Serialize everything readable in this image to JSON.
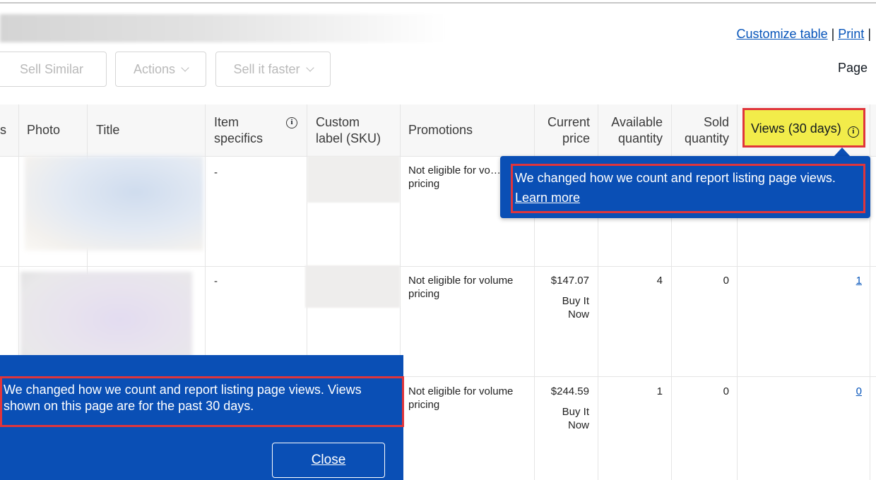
{
  "toolbar": {
    "customize_table": "Customize table",
    "separator": "|",
    "print": "Print",
    "sell_similar": "Sell Similar",
    "actions": "Actions",
    "sell_it_faster": "Sell it faster",
    "page_label": "Page"
  },
  "table": {
    "headers": {
      "partial_first": "s",
      "photo": "Photo",
      "title": "Title",
      "item_specifics_line1": "Item",
      "item_specifics_line2": "specifics",
      "custom_label_line1": "Custom",
      "custom_label_line2": "label (SKU)",
      "promotions": "Promotions",
      "current_price_line1": "Current",
      "current_price_line2": "price",
      "available_qty_line1": "Available",
      "available_qty_line2": "quantity",
      "sold_qty_line1": "Sold",
      "sold_qty_line2": "quantity",
      "views": "Views (30 days)"
    },
    "rows": [
      {
        "item_specifics": "-",
        "promotions": "Not eligible for vo…",
        "promotions_line2": "pricing"
      },
      {
        "item_specifics": "-",
        "promotions": "Not eligible for volume",
        "promotions_line2": "pricing",
        "price": "$147.07",
        "format_line1": "Buy It",
        "format_line2": "Now",
        "available": "4",
        "sold": "0",
        "views": "1"
      },
      {
        "promotions": "Not eligible for volume",
        "promotions_line2": "pricing",
        "price": "$244.59",
        "format_line1": "Buy It",
        "format_line2": "Now",
        "available": "1",
        "sold": "0",
        "views": "0"
      }
    ]
  },
  "tooltip": {
    "text": "We changed how we count and report listing page views.",
    "link": "Learn more"
  },
  "popup": {
    "text": "We changed how we count and report listing page views. Views shown on this page are for the past 30 days.",
    "close": "Close"
  },
  "info_icon_glyph": "i",
  "colors": {
    "accent_blue": "#0a4fb5",
    "link_blue": "#0654ba",
    "highlight_yellow": "#f2ec4a",
    "annotation_red": "#e0353b"
  }
}
